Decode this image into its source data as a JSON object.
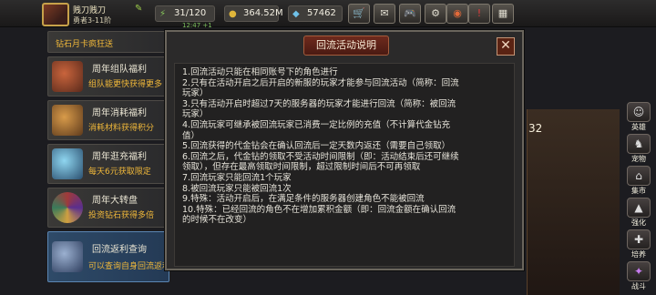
{
  "topbar": {
    "player_name": "贱刀贱刀",
    "player_rank": "勇者3-11阶",
    "sub_status": "12:47 +1",
    "resources": [
      {
        "icon": "stamina-icon",
        "value": "31/120"
      },
      {
        "icon": "gold-coin-icon",
        "value": "364.52M"
      },
      {
        "icon": "diamond-icon",
        "value": "57462"
      }
    ],
    "buttons": [
      {
        "name": "shop-cart-button",
        "icon": "cart-icon",
        "glyph": "🛒"
      },
      {
        "name": "mail-button",
        "icon": "mail-icon",
        "glyph": "✉"
      },
      {
        "name": "gamepad-button",
        "icon": "gamepad-icon",
        "glyph": "🎮"
      },
      {
        "name": "settings-button",
        "icon": "gear-icon",
        "glyph": "⚙"
      },
      {
        "name": "event-button",
        "icon": "colorful-ring-icon",
        "glyph": "◉"
      },
      {
        "name": "alert-button",
        "icon": "warning-icon",
        "glyph": "!"
      },
      {
        "name": "grid-menu-button",
        "icon": "grid-icon",
        "glyph": "▦"
      }
    ]
  },
  "sidebar": {
    "items": [
      {
        "title": "",
        "desc": "钻石月卡疯狂送",
        "thumb": "#5a3a6e"
      },
      {
        "title": "周年组队福利",
        "desc": "组队能更快获得更多",
        "thumb": "#8a3b2a"
      },
      {
        "title": "周年消耗福利",
        "desc": "消耗材料获得积分",
        "thumb": "#8b5a2e"
      },
      {
        "title": "周年逛充福利",
        "desc": "每天6元获取限定",
        "thumb": "#2e5a7c"
      },
      {
        "title": "周年大转盘",
        "desc": "投资钻石获得多倍",
        "thumb": "#5a2e6e"
      },
      {
        "title": "回流返利查询",
        "desc": "可以查询自身回流返利",
        "thumb": "#3a4e6e"
      }
    ]
  },
  "right_panel": {
    "count": "32"
  },
  "right_buttons": [
    {
      "name": "hero",
      "label": "英雄",
      "glyph": "☺"
    },
    {
      "name": "pet",
      "label": "宠物",
      "glyph": "♞"
    },
    {
      "name": "market",
      "label": "集市",
      "glyph": "⌂"
    },
    {
      "name": "enhance",
      "label": "强化",
      "glyph": "▲"
    },
    {
      "name": "cultivate",
      "label": "培养",
      "glyph": "✚"
    },
    {
      "name": "battle",
      "label": "战斗",
      "glyph": "✦"
    }
  ],
  "dialog": {
    "title": "回流活动说明",
    "close_label": "✕",
    "rules": [
      "1.回流活动只能在相同账号下的角色进行",
      "2.只有在活动开启之后开启的新服的玩家才能参与回流活动（简称：回流",
      "玩家）",
      "3.只有活动开启时超过7天的服务器的玩家才能进行回流（简称：被回流",
      "玩家）",
      "4.回流玩家可继承被回流玩家已消费一定比例的充值（不计算代金钻充",
      "值）",
      "5.回流获得的代金钻会在确认回流后一定天数内返还（需要自己领取）",
      "6.回流之后，代金钻的领取不受活动时间限制（即：活动结束后还可继续",
      "领取），但存在最高领取时间限制，超过限制时间后不可再领取",
      "7.回流玩家只能回流1个玩家",
      "8.被回流玩家只能被回流1次",
      "9.特殊：活动开启后，在满足条件的服务器创建角色不能被回流",
      "10.特殊：已经回流的角色不在增加累积金额（即：回流金额在确认回流",
      "的时候不在改变）"
    ]
  }
}
